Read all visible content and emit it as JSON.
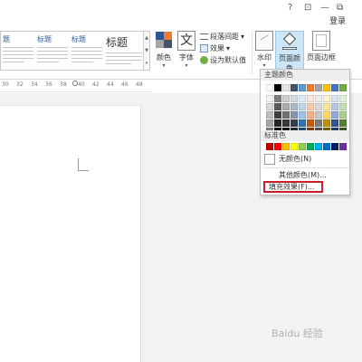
{
  "window": {
    "controls": [
      "?",
      "⊡",
      "—",
      "⧉"
    ],
    "login": "登录"
  },
  "ribbon": {
    "style_thumbs": [
      {
        "title": "题",
        "big": false
      },
      {
        "title": "标题",
        "big": false
      },
      {
        "title": "标题",
        "big": false
      },
      {
        "title": "标题",
        "big": true
      }
    ],
    "colors_label": "颜色",
    "fonts_label": "字体",
    "fonts_glyph": "文",
    "paragraph_spacing_label": "段落间距",
    "effects_label": "效果",
    "set_default_label": "设为默认值",
    "watermark_label": "水印",
    "page_color_label": "页面颜色",
    "page_border_label": "页面边框"
  },
  "ruler": {
    "ticks": [
      "30",
      "32",
      "34",
      "36",
      "38",
      "40",
      "42",
      "44",
      "46",
      "48"
    ]
  },
  "dropdown": {
    "theme_colors_label": "主题颜色",
    "theme_colors": [
      [
        "#ffffff",
        "#000000",
        "#e7e6e6",
        "#44546a",
        "#5b9bd5",
        "#ed7d31",
        "#a5a5a5",
        "#ffc000",
        "#4472c4",
        "#70ad47"
      ],
      [
        "#f2f2f2",
        "#7f7f7f",
        "#d0cece",
        "#d6dce4",
        "#ddebf7",
        "#fbe5d6",
        "#ededed",
        "#fff2cc",
        "#dae3f3",
        "#e2f0d9"
      ],
      [
        "#d9d9d9",
        "#595959",
        "#aeabab",
        "#adb9ca",
        "#bdd7ee",
        "#f8cbad",
        "#dbdbdb",
        "#ffe699",
        "#b4c7e7",
        "#c5e0b4"
      ],
      [
        "#bfbfbf",
        "#404040",
        "#757171",
        "#8496b0",
        "#9dc3e6",
        "#f4b183",
        "#c9c9c9",
        "#ffd966",
        "#8faadc",
        "#a9d18e"
      ],
      [
        "#a6a6a6",
        "#262626",
        "#3a3838",
        "#333f50",
        "#2e75b6",
        "#c55a11",
        "#7b7b7b",
        "#bf9000",
        "#2f5597",
        "#548235"
      ],
      [
        "#808080",
        "#0d0d0d",
        "#171616",
        "#222a35",
        "#1f4e79",
        "#843c0c",
        "#525252",
        "#7f6000",
        "#203864",
        "#385723"
      ]
    ],
    "standard_colors_label": "标准色",
    "standard_colors": [
      "#c00000",
      "#ff0000",
      "#ffc000",
      "#ffff00",
      "#92d050",
      "#00b050",
      "#00b0f0",
      "#0070c0",
      "#002060",
      "#7030a0"
    ],
    "no_color_label": "无颜色(N)",
    "more_colors_label": "其他颜色(M)...",
    "fill_effects_label": "填充效果(F)..."
  },
  "watermark_text": "Baidu 经验"
}
